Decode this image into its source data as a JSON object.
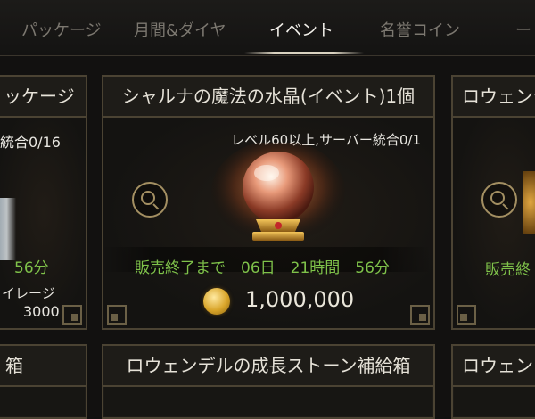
{
  "tabs": [
    {
      "label": "パッケージ",
      "active": false
    },
    {
      "label": "月間&ダイヤ",
      "active": false
    },
    {
      "label": "イベント",
      "active": true
    },
    {
      "label": "名誉コイン",
      "active": false
    },
    {
      "label": "ー",
      "active": false
    }
  ],
  "left_card": {
    "title": "ッケージ",
    "limit": "統合0/16",
    "timer": "56分",
    "mileage_label": "イレージ",
    "mileage_value": "3000"
  },
  "center_card": {
    "title": "シャルナの魔法の水晶(イベント)1個",
    "requirement": "レベル60以上,サーバー統合0/1",
    "sale_end": "販売終了まで　06日　21時間　56分",
    "price": "1,000,000"
  },
  "right_card": {
    "title": "ロウェンデ",
    "sale_end": "販売終"
  },
  "bottom_row": {
    "left_title": "箱",
    "center_title": "ロウェンデルの成長ストーン補給箱",
    "right_title": "ロウェン"
  },
  "colors": {
    "accent_green": "#7fc24a",
    "border_gold": "#4b4333",
    "coin_gold": "#d9a52a"
  }
}
